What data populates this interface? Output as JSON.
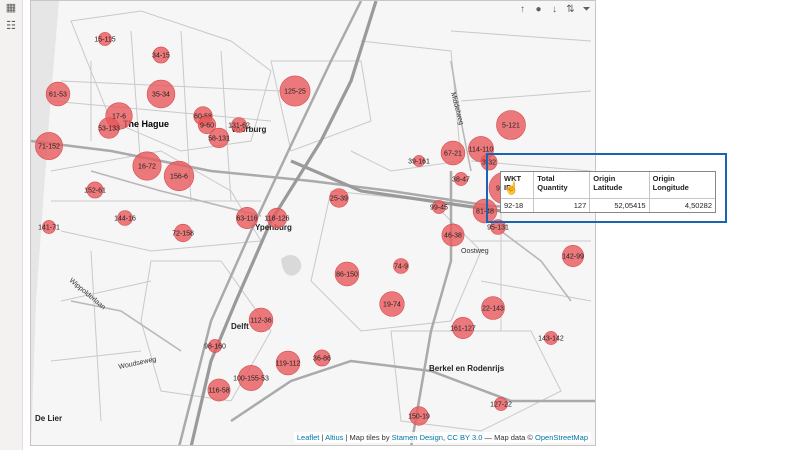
{
  "rail": {
    "icons": [
      "report-view-icon",
      "data-view-icon"
    ]
  },
  "toolbar": {
    "icons": [
      "pin-icon",
      "drill-down-icon",
      "drill-up-icon",
      "expand-icon",
      "filter-icon",
      "focus-mode-icon",
      "more-options-icon"
    ],
    "glyphs": [
      "↑",
      "●",
      "↓",
      "⇅",
      "⏷",
      "⛶",
      "…"
    ]
  },
  "map": {
    "labels": {
      "the_hague": "The Hague",
      "voorburg": "Voorburg",
      "ypenburg": "Ypenburg",
      "delft": "Delft",
      "berkel": "Berkel en Rodenrijs",
      "de_lier": "De Lier",
      "middelweg": "Middelweg",
      "oostweg": "Oostweg",
      "woudseweg": "Woudseweg",
      "wippolderlaan": "Wippolderlaan"
    },
    "bubble_color": "#e8595b",
    "points": [
      {
        "id": "15-115",
        "q": 10
      },
      {
        "id": "34-15",
        "q": 20
      },
      {
        "id": "61-53",
        "q": 60
      },
      {
        "id": "35-34",
        "q": 90
      },
      {
        "id": "125-25",
        "q": 110
      },
      {
        "id": "17-6",
        "q": 80
      },
      {
        "id": "53-133",
        "q": 40
      },
      {
        "id": "60-58",
        "q": 30
      },
      {
        "id": "9-60",
        "q": 25
      },
      {
        "id": "131-62",
        "q": 15
      },
      {
        "id": "58-131",
        "q": 35
      },
      {
        "id": "71-152",
        "q": 85
      },
      {
        "id": "16-72",
        "q": 95
      },
      {
        "id": "156-6",
        "q": 105
      },
      {
        "id": "152-61",
        "q": 20
      },
      {
        "id": "144-16",
        "q": 15
      },
      {
        "id": "141-71",
        "q": 10
      },
      {
        "id": "72-158",
        "q": 25
      },
      {
        "id": "63-116",
        "q": 45
      },
      {
        "id": "118-126",
        "q": 35
      },
      {
        "id": "25-39",
        "q": 30
      },
      {
        "id": "5-121",
        "q": 100
      },
      {
        "id": "67-21",
        "q": 60
      },
      {
        "id": "114-110",
        "q": 70
      },
      {
        "id": "3-32",
        "q": 20
      },
      {
        "id": "39-161",
        "q": 5
      },
      {
        "id": "38-47",
        "q": 10
      },
      {
        "id": "92-18",
        "q": 127
      },
      {
        "id": "99-45",
        "q": 10
      },
      {
        "id": "81-48",
        "q": 60
      },
      {
        "id": "95-131",
        "q": 15
      },
      {
        "id": "46-38",
        "q": 50
      },
      {
        "id": "142-99",
        "q": 45
      },
      {
        "id": "74-9",
        "q": 15
      },
      {
        "id": "86-150",
        "q": 60
      },
      {
        "id": "19-74",
        "q": 65
      },
      {
        "id": "22-143",
        "q": 55
      },
      {
        "id": "112-36",
        "q": 60
      },
      {
        "id": "161-127",
        "q": 45
      },
      {
        "id": "143-142",
        "q": 10
      },
      {
        "id": "98-160",
        "q": 10
      },
      {
        "id": "36-86",
        "q": 20
      },
      {
        "id": "119-112",
        "q": 60
      },
      {
        "id": "100-155-53",
        "q": 70
      },
      {
        "id": "116-58",
        "q": 50
      },
      {
        "id": "150-19",
        "q": 30
      },
      {
        "id": "127-22",
        "q": 10
      }
    ]
  },
  "tooltip": {
    "headers": [
      "WKT ID",
      "Total Quantity",
      "Origin Latitude",
      "Origin Longitude"
    ],
    "row": [
      "92-18",
      "127",
      "52,05415",
      "4,50282"
    ]
  },
  "attribution": {
    "leaflet": "Leaflet",
    "sep1": " | ",
    "altius": "Altius",
    "tiles_prefix": " | Map tiles by ",
    "stamen": "Stamen Design",
    "comma": ", ",
    "cc": "CC BY 3.0",
    "data_prefix": " — Map data © ",
    "osm": "OpenStreetMap"
  }
}
